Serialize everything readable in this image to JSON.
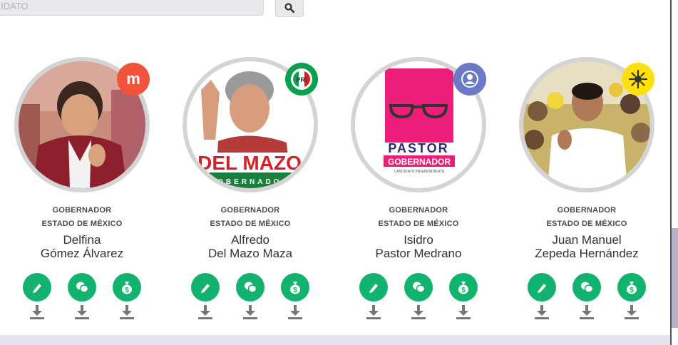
{
  "search": {
    "placeholder": "IDATO",
    "button_icon": "search-icon"
  },
  "colors": {
    "accent": "#12b36e",
    "ring": "#d4d4d4",
    "morena": "#f1543b",
    "pri": "#0aa04e",
    "independent": "#6c78c8",
    "prd": "#ffe10a"
  },
  "candidates": [
    {
      "role": "GOBERNADOR",
      "state": "ESTADO DE MÉXICO",
      "first": "Delfina",
      "last": "Gómez Álvarez",
      "party_icon": "morena-logo",
      "party_letter": "m"
    },
    {
      "role": "GOBERNADOR",
      "state": "ESTADO DE MÉXICO",
      "first": "Alfredo",
      "last": "Del Mazo Maza",
      "party_icon": "pri-logo",
      "party_letter": "PRI",
      "banner": "DEL MAZO",
      "banner_sub": "GOBERNADOR"
    },
    {
      "role": "GOBERNADOR",
      "state": "ESTADO DE MÉXICO",
      "first": "Isidro",
      "last": "Pastor Medrano",
      "party_icon": "independent-logo",
      "poster_title": "PASTOR",
      "poster_sub": "GOBERNADOR",
      "poster_small": "CANDIDATO INDEPENDIENTE"
    },
    {
      "role": "GOBERNADOR",
      "state": "ESTADO DE MÉXICO",
      "first": "Juan Manuel",
      "last": "Zepeda Hernández",
      "party_icon": "prd-logo"
    }
  ],
  "action_icons": [
    "pen-icon",
    "chat-bubbles-icon",
    "money-bag-icon"
  ],
  "download_icon": "download-icon"
}
